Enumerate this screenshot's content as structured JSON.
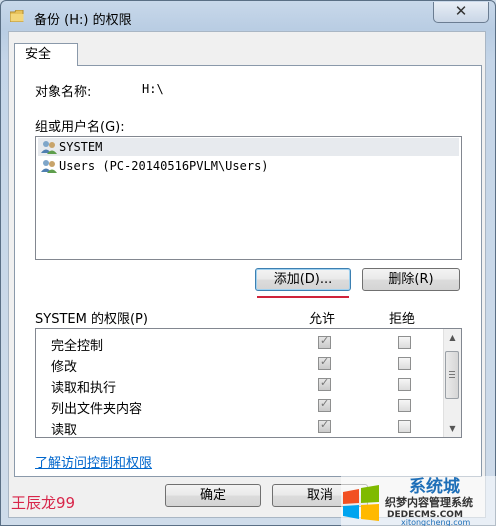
{
  "window": {
    "title": "备份 (H:) 的权限",
    "close_symbol": "✕"
  },
  "tabs": [
    {
      "label": "安全"
    }
  ],
  "object": {
    "label": "对象名称:",
    "value": "H:\\"
  },
  "groups": {
    "label": "组或用户名(G):",
    "items": [
      {
        "name": "SYSTEM",
        "icon": "users-icon",
        "selected": true
      },
      {
        "name": "Users (PC-20140516PVLM\\Users)",
        "icon": "users-icon",
        "selected": false
      }
    ]
  },
  "buttons": {
    "add": "添加(D)...",
    "remove": "删除(R)",
    "ok": "确定",
    "cancel": "取消"
  },
  "permissions": {
    "label": "SYSTEM 的权限(P)",
    "allow_header": "允许",
    "deny_header": "拒绝",
    "rows": [
      {
        "name": "完全控制",
        "allow": true,
        "deny": false
      },
      {
        "name": "修改",
        "allow": true,
        "deny": false
      },
      {
        "name": "读取和执行",
        "allow": true,
        "deny": false
      },
      {
        "name": "列出文件夹内容",
        "allow": true,
        "deny": false
      },
      {
        "name": "读取",
        "allow": true,
        "deny": false
      }
    ]
  },
  "help_link": "了解访问控制和权限",
  "watermark": "王辰龙99",
  "logo": {
    "line1": "系统城",
    "line2": "织梦内容管理系统",
    "line3": "DEDECMS.COM",
    "line4": "xitongcheng.com"
  },
  "colors": {
    "accent_red": "#d0233b",
    "link": "#0066cc"
  }
}
